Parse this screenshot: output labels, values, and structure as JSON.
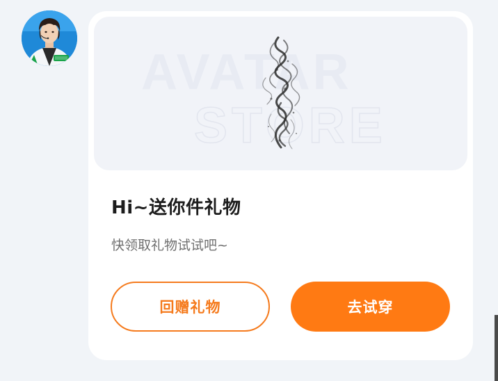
{
  "colors": {
    "page_bg": "#f1f4f8",
    "card_bg": "#ffffff",
    "banner_bg": "#f1f3f8",
    "accent": "#ff7a13"
  },
  "sender": {
    "avatar_icon": "user-avatar"
  },
  "gift_card": {
    "banner": {
      "watermark_line1": "AVATAR",
      "watermark_line2": "STORE",
      "image_icon": "smoke-artwork"
    },
    "title": "Hi~送你件礼物",
    "subtitle": "快领取礼物试试吧~",
    "buttons": {
      "return_gift": "回赠礼物",
      "try_on": "去试穿"
    }
  }
}
